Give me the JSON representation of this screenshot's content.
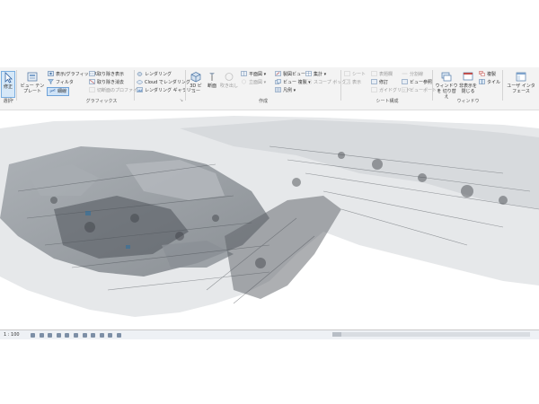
{
  "ribbon": {
    "select": {
      "modify_label": "修正",
      "group_label": "選択"
    },
    "graphics": {
      "view_template_label": "ビュー テンプレート",
      "visibility_graphics_label": "表示/グラフィックス",
      "filter_label": "フィルタ",
      "thin_lines_label": "細線",
      "show_hidden_label": "取り除き表示",
      "remove_hidden_label": "取り除き消去",
      "cut_profile_label": "切断面のプロファイル",
      "group_label": "グラフィックス"
    },
    "presentation": {
      "render_label": "レンダリング",
      "cloud_render_label": "Cloud でレンダリング",
      "render_gallery_label": "レンダリング ギャラリー"
    },
    "create": {
      "view3d_label": "3D ビュー",
      "section_label": "断面",
      "callout_label": "吹き出し",
      "plan_views_label": "平面図",
      "elevation_label": "立面図",
      "drafting_view_label": "製図ビュー",
      "duplicate_view_label": "ビュー 複製",
      "legends_label": "凡例",
      "schedules_label": "集計",
      "scope_box_label": "スコープ ボックス",
      "group_label": "作成"
    },
    "sheet": {
      "sheet_label": "シート",
      "titleblock_label": "表題欄",
      "guide_grid_label": "ガイドグリッド",
      "view_label": "表示",
      "revisions_label": "修訂",
      "matchline_label": "分割線",
      "view_reference_label": "ビュー参照",
      "viewports_label": "ビューポート",
      "group_label": "シート構成"
    },
    "windows": {
      "switch_windows_label": "ウィンドウを 切り替え",
      "close_inactive_label": "非表示を 閉じる",
      "cascade_label": "複製",
      "tile_label": "タイル",
      "group_label": "ウィンドウ"
    },
    "ui": {
      "user_interface_label": "ユーザ インタフェース"
    }
  },
  "statusbar": {
    "scale": "1 : 100"
  },
  "colors": {
    "accent": "#2e7bd6",
    "ribbon_bg": "#f3f3f3",
    "pointcloud_dark": "#3b3f44",
    "pointcloud_mid": "#8a8f96"
  }
}
